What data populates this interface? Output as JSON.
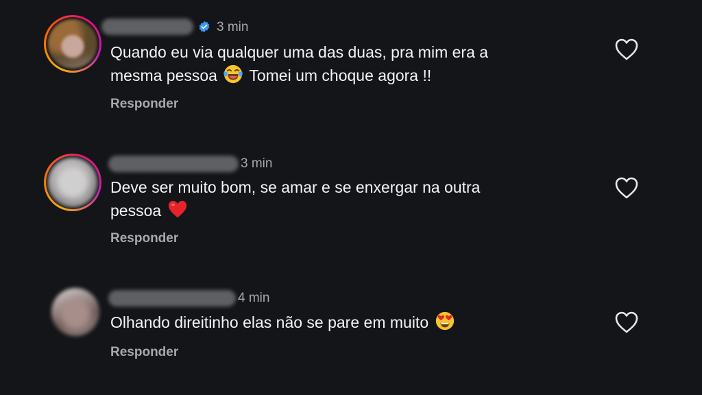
{
  "comments": [
    {
      "time": "3 min",
      "verified": true,
      "line1": "Quando eu via qualquer uma das duas, pra mim era a",
      "line2_before": "mesma pessoa",
      "line2_emoji": "face-with-tears-of-joy-emoji",
      "line2_after": "Tomei um choque agora !!",
      "reply_label": "Responder",
      "like_icon": "heart-outline-icon"
    },
    {
      "time": "3 min",
      "verified": false,
      "line1": "Deve ser muito bom, se amar e se enxergar na outra",
      "line2_before": "pessoa",
      "line2_emoji": "red-heart-emoji",
      "reply_label": "Responder",
      "like_icon": "heart-outline-icon"
    },
    {
      "time": "4 min",
      "verified": false,
      "line1_before": "Olhando direitinho elas não se pare em muito",
      "line1_emoji": "heart-eyes-emoji",
      "reply_label": "Responder",
      "like_icon": "heart-outline-icon"
    }
  ],
  "colors": {
    "background": "#141518",
    "text": "#f4f4f6",
    "secondary_text": "#a8a9ad",
    "verified_badge": "#3897f0"
  }
}
